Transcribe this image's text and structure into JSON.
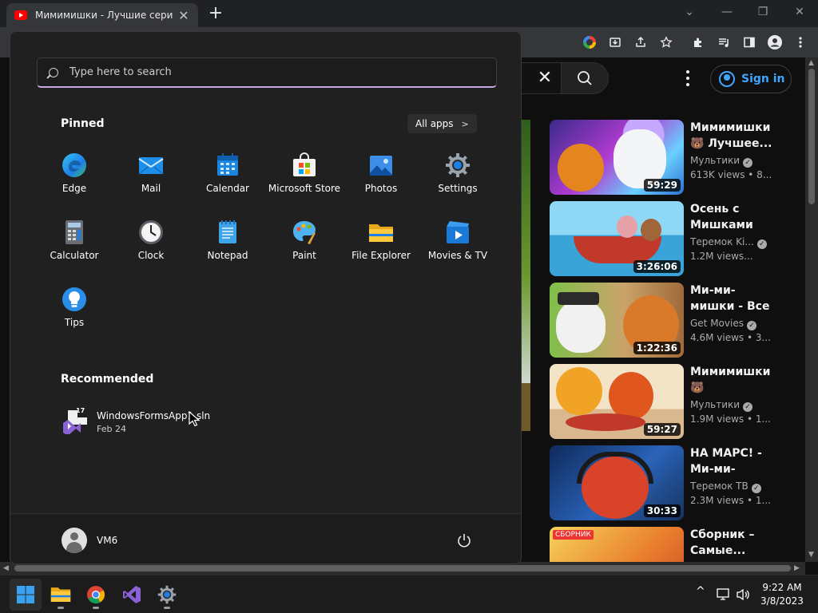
{
  "browser": {
    "tab_title": "Мимимишки - Лучшие серии с",
    "tab_close": "✕",
    "new_tab": "+",
    "controls": {
      "min": "—",
      "max": "❐",
      "close": "✕",
      "tabsearch": "⌄"
    }
  },
  "youtube": {
    "signin_label": "Sign in",
    "clear_glyph": "✕",
    "recommendations": [
      {
        "title": "Мимимишки 🐻 Лучшее...",
        "channel": "Мультики",
        "views": "613K views • 8...",
        "duration": "59:29"
      },
      {
        "title": "Осень с Мишками 🍃...",
        "channel": "Теремок Ki...",
        "views": "1.2M views...",
        "duration": "3:26:06"
      },
      {
        "title": "Ми-ми-мишки - Все серии...",
        "channel": "Get Movies",
        "views": "4.6M views • 3...",
        "duration": "1:22:36"
      },
      {
        "title": "Мимимишки 🐻 Пещера,...",
        "channel": "Мультики",
        "views": "1.9M views • 1...",
        "duration": "59:27"
      },
      {
        "title": "НА МАРС! - Ми-ми-мишк...",
        "channel": "Теремок ТВ",
        "views": "2.3M views • 1...",
        "duration": "30:33"
      },
      {
        "title": "Сборник – Самые...",
        "channel": "",
        "views": "",
        "duration": "",
        "badge": "СБОРНИК"
      }
    ]
  },
  "start_menu": {
    "search_placeholder": "Type here to search",
    "pinned_heading": "Pinned",
    "all_apps_label": "All apps",
    "all_apps_chevron": ">",
    "apps": [
      {
        "label": "Edge",
        "icon": "edge-icon"
      },
      {
        "label": "Mail",
        "icon": "mail-icon"
      },
      {
        "label": "Calendar",
        "icon": "calendar-icon"
      },
      {
        "label": "Microsoft Store",
        "icon": "store-icon"
      },
      {
        "label": "Photos",
        "icon": "photos-icon"
      },
      {
        "label": "Settings",
        "icon": "settings-icon"
      },
      {
        "label": "Calculator",
        "icon": "calculator-icon"
      },
      {
        "label": "Clock",
        "icon": "clock-icon"
      },
      {
        "label": "Notepad",
        "icon": "notepad-icon"
      },
      {
        "label": "Paint",
        "icon": "paint-icon"
      },
      {
        "label": "File Explorer",
        "icon": "folder-icon"
      },
      {
        "label": "Movies & TV",
        "icon": "movies-icon"
      },
      {
        "label": "Tips",
        "icon": "tips-icon"
      }
    ],
    "recommended_heading": "Recommended",
    "recommended": [
      {
        "name": "WindowsFormsApp1.sln",
        "date": "Feb 24",
        "badge": "17"
      }
    ],
    "user_name": "VM6"
  },
  "taskbar": {
    "time": "9:22 AM",
    "date": "3/8/2023",
    "chevron": "^"
  },
  "colors": {
    "accent_search_underline": "#c7a6e4",
    "youtube_link": "#3ea6ff",
    "youtube_red": "#ff0000"
  }
}
